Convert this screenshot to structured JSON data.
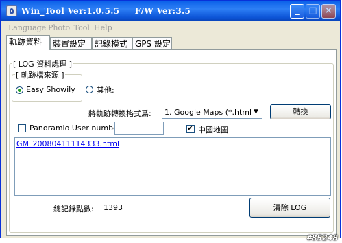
{
  "window": {
    "title": "Win_Tool Ver:1.0.5.5     F/W Ver:3.5",
    "controls": {
      "minimize": "_",
      "maximize": "□",
      "close": "×"
    }
  },
  "menu": [
    "Language",
    "Photo_Tool",
    "Help"
  ],
  "tabs": [
    "軌跡資料",
    "裝置設定",
    "記錄模式",
    "GPS 設定"
  ],
  "log_group": {
    "label": "[ LOG 資料處理 ]",
    "source_group": {
      "label": "[ 軌跡檔來源 ]",
      "options": [
        "Easy Showily",
        "其他:"
      ],
      "selected": "Easy Showily"
    },
    "convert_label": "將軌跡轉換格式爲:",
    "format_select": "1. Google Maps (*.html)",
    "convert_button": "轉換",
    "panoramio_label": "Panoramio User number",
    "panoramio_value": "",
    "china_map_label": "中國地圖",
    "china_map_checked": true,
    "files": [
      "GM_20080411114333.html"
    ],
    "total_points_label": "總記錄點數:",
    "total_points_value": "1393",
    "clear_button": "清除 LOG"
  },
  "watermark": "#85248"
}
